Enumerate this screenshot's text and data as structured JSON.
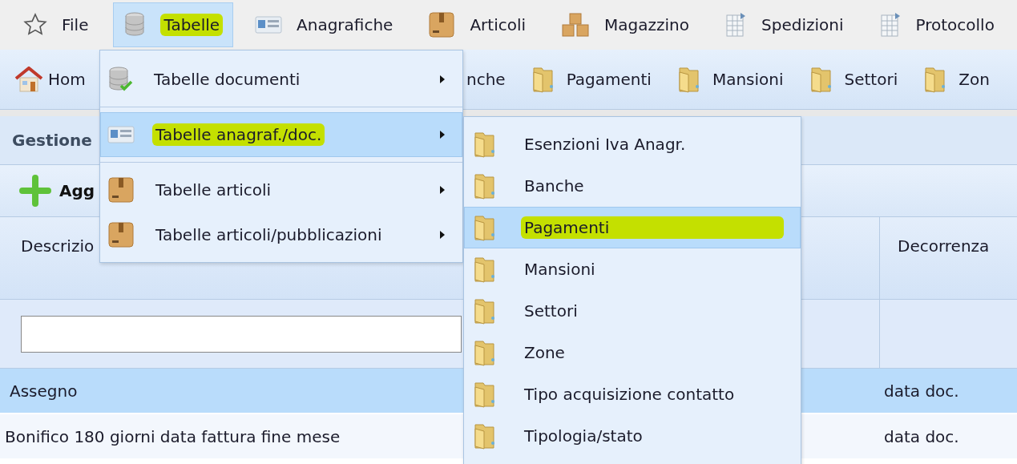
{
  "menubar": {
    "items": [
      {
        "label": "File",
        "kind": "favorites",
        "selected": false,
        "marked": false
      },
      {
        "label": "Tabelle",
        "kind": "tables",
        "selected": true,
        "marked": true
      },
      {
        "label": "Anagrafiche",
        "kind": "registry",
        "selected": false,
        "marked": false
      },
      {
        "label": "Articoli",
        "kind": "articles",
        "selected": false,
        "marked": false
      },
      {
        "label": "Magazzino",
        "kind": "warehouse",
        "selected": false,
        "marked": false
      },
      {
        "label": "Spedizioni",
        "kind": "document",
        "selected": false,
        "marked": false
      },
      {
        "label": "Protocollo",
        "kind": "document",
        "selected": false,
        "marked": false
      }
    ]
  },
  "toolbar": {
    "items": [
      {
        "label": "Hom",
        "kind": "home"
      },
      {
        "label": "nche",
        "kind": "none"
      },
      {
        "label": "Pagamenti",
        "kind": "folder"
      },
      {
        "label": "Mansioni",
        "kind": "folder"
      },
      {
        "label": "Settori",
        "kind": "folder"
      },
      {
        "label": "Zon",
        "kind": "folder"
      }
    ]
  },
  "panel": {
    "title": "Gestione",
    "add_button": "Agg",
    "table": {
      "columns": [
        "Descrizio",
        "Decorrenza"
      ],
      "rows": [
        {
          "cells": [
            "Assegno",
            "data doc."
          ],
          "selected": true
        },
        {
          "cells": [
            "Bonifico 180 giorni data fattura fine mese",
            "data doc."
          ],
          "selected": false
        }
      ]
    }
  },
  "dropdown": {
    "items": [
      {
        "label": "Tabelle documenti",
        "kind": "tables-check",
        "selected": false,
        "marked": false,
        "has_submenu": true,
        "separator_after": true
      },
      {
        "label": "Tabelle anagraf./doc.",
        "kind": "registry",
        "selected": true,
        "marked": true,
        "has_submenu": true,
        "separator_after": true
      },
      {
        "label": "Tabelle articoli",
        "kind": "articles",
        "selected": false,
        "marked": false,
        "has_submenu": true,
        "separator_after": false
      },
      {
        "label": "Tabelle articoli/pubblicazioni",
        "kind": "articles",
        "selected": false,
        "marked": false,
        "has_submenu": true,
        "separator_after": false
      }
    ]
  },
  "submenu": {
    "items": [
      {
        "label": "Esenzioni Iva Anagr.",
        "selected": false,
        "marked": false
      },
      {
        "label": "Banche",
        "selected": false,
        "marked": false
      },
      {
        "label": "Pagamenti",
        "selected": true,
        "marked": true
      },
      {
        "label": "Mansioni",
        "selected": false,
        "marked": false
      },
      {
        "label": "Settori",
        "selected": false,
        "marked": false
      },
      {
        "label": "Zone",
        "selected": false,
        "marked": false
      },
      {
        "label": "Tipo acquisizione contatto",
        "selected": false,
        "marked": false
      },
      {
        "label": "Tipologia/stato",
        "selected": false,
        "marked": false
      }
    ]
  }
}
